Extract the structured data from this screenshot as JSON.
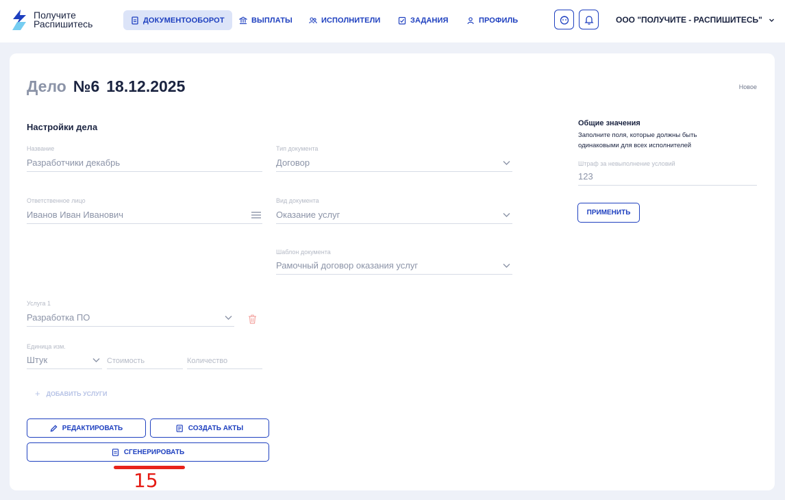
{
  "brand": {
    "line1": "Получите",
    "line2": "Распишитесь"
  },
  "nav": [
    {
      "label": "ДОКУМЕНТООБОРОТ",
      "icon": "document-icon",
      "active": true
    },
    {
      "label": "ВЫПЛАТЫ",
      "icon": "bank-icon",
      "active": false
    },
    {
      "label": "ИСПОЛНИТЕЛИ",
      "icon": "users-icon",
      "active": false
    },
    {
      "label": "ЗАДАНИЯ",
      "icon": "checklist-icon",
      "active": false
    },
    {
      "label": "ПРОФИЛЬ",
      "icon": "user-icon",
      "active": false
    }
  ],
  "header": {
    "company": "ООО \"ПОЛУЧИТЕ - РАСПИШИТЕСЬ\""
  },
  "deal": {
    "word": "Дело",
    "number": "№6",
    "date": "18.12.2025",
    "status": "Новое",
    "settings_title": "Настройки дела"
  },
  "form": {
    "name": {
      "label": "Название",
      "value": "Разработчики декабрь"
    },
    "doc_type": {
      "label": "Тип документа",
      "value": "Договор"
    },
    "responsible": {
      "label": "Ответственное лицо",
      "value": "Иванов Иван Иванович"
    },
    "doc_kind": {
      "label": "Вид документа",
      "value": "Оказание услуг"
    },
    "template": {
      "label": "Шаблон документа",
      "value": "Рамочный договор оказания услуг"
    },
    "service": {
      "label": "Услуга 1",
      "value": "Разработка ПО"
    },
    "unit": {
      "label": "Единица изм.",
      "value": "Штук"
    },
    "cost": {
      "placeholder": "Стоимость"
    },
    "quantity": {
      "placeholder": "Количество"
    },
    "add_service": "ДОБАВИТЬ УСЛУГИ"
  },
  "buttons": {
    "edit": "РЕДАКТИРОВАТЬ",
    "create_acts": "СОЗДАТЬ АКТЫ",
    "generate": "СГЕНЕРИРОВАТЬ",
    "apply": "ПРИМЕНИТЬ"
  },
  "common": {
    "title": "Общие значения",
    "description": "Заполните поля, которые должны быть одинаковыми для всех исполнителей",
    "penalty": {
      "label": "Штраф за невыполнение условий",
      "value": "123"
    }
  },
  "annotation": {
    "step": "15"
  },
  "colors": {
    "primary": "#1d3fbf",
    "annotation": "#e51b14",
    "active_nav_bg": "#dce4f8"
  }
}
